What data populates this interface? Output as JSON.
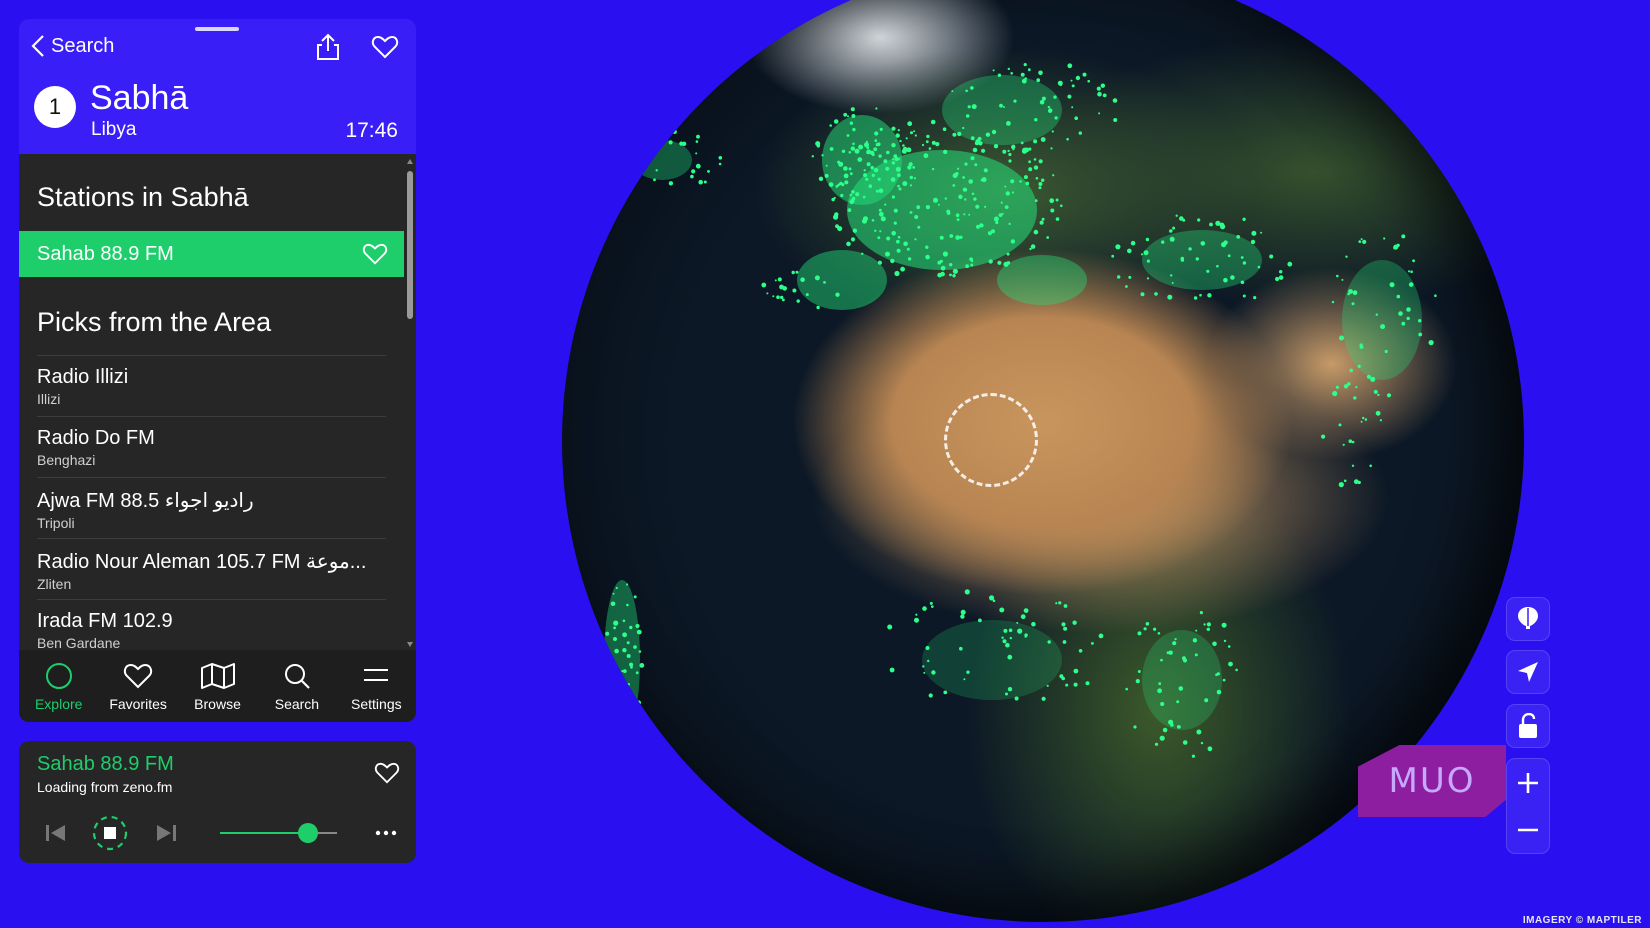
{
  "header": {
    "back_label": "Search",
    "station_number": "1",
    "city": "Sabhā",
    "country": "Libya",
    "local_time": "17:46"
  },
  "stations_section": {
    "title": "Stations in Sabhā",
    "active_station": "Sahab 88.9 FM"
  },
  "picks_section": {
    "title": "Picks from the Area",
    "items": [
      {
        "name": "Radio Illizi",
        "location": "Illizi"
      },
      {
        "name": "Radio Do FM",
        "location": "Benghazi"
      },
      {
        "name": "Ajwa FM 88.5 راديو اجواء",
        "location": "Tripoli"
      },
      {
        "name": "Radio Nour Aleman 105.7 FM موعة...",
        "location": "Zliten"
      },
      {
        "name": "Irada FM 102.9",
        "location": "Ben Gardane"
      }
    ]
  },
  "tabs": [
    {
      "label": "Explore",
      "icon": "explore-circle-icon",
      "active": true
    },
    {
      "label": "Favorites",
      "icon": "heart-icon",
      "active": false
    },
    {
      "label": "Browse",
      "icon": "map-icon",
      "active": false
    },
    {
      "label": "Search",
      "icon": "search-icon",
      "active": false
    },
    {
      "label": "Settings",
      "icon": "menu-icon",
      "active": false
    }
  ],
  "player": {
    "station": "Sahab 88.9 FM",
    "status": "Loading from zeno.fm",
    "volume_percent": 75
  },
  "map": {
    "attribution": "IMAGERY © MAPTILER",
    "watermark": "MUO"
  },
  "colors": {
    "background": "#2a10f0",
    "header": "#3a1ef7",
    "accent": "#1dce6b",
    "panel": "#262626"
  }
}
